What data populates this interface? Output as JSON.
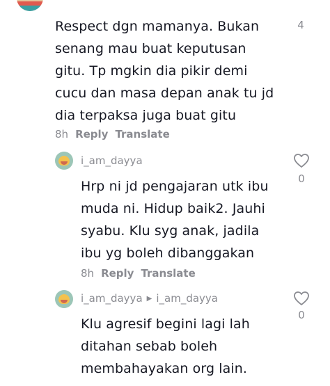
{
  "top_comment": {
    "text": "Respect dgn mamanya. Bukan\nsenang mau buat keputusan\ngitu. Tp mgkin dia pikir demi\ncucu dan masa depan anak tu jd\ndia terpaksa juga buat gitu",
    "time": "8h",
    "reply_label": "Reply",
    "translate_label": "Translate",
    "likes": "4"
  },
  "replies": [
    {
      "username": "i_am_dayya",
      "reply_to": "",
      "text": "Hrp ni jd pengajaran utk ibu\nmuda ni. Hidup baik2. Jauhi\nsyabu. Klu syg anak, jadila\nibu yg boleh dibanggakan",
      "time": "8h",
      "reply_label": "Reply",
      "translate_label": "Translate",
      "likes": "0"
    },
    {
      "username": "i_am_dayya",
      "reply_to": "i_am_dayya",
      "text": "Klu agresif begini lagi lah\nditahan sebab boleh\nmembahayakan org lain.",
      "likes": "0"
    }
  ],
  "colors": {
    "text_primary": "#161823",
    "text_secondary": "#8a8b91",
    "background": "#ffffff"
  },
  "icons": {
    "like": "heart-outline-icon",
    "reply_arrow": "triangle-right-icon"
  }
}
